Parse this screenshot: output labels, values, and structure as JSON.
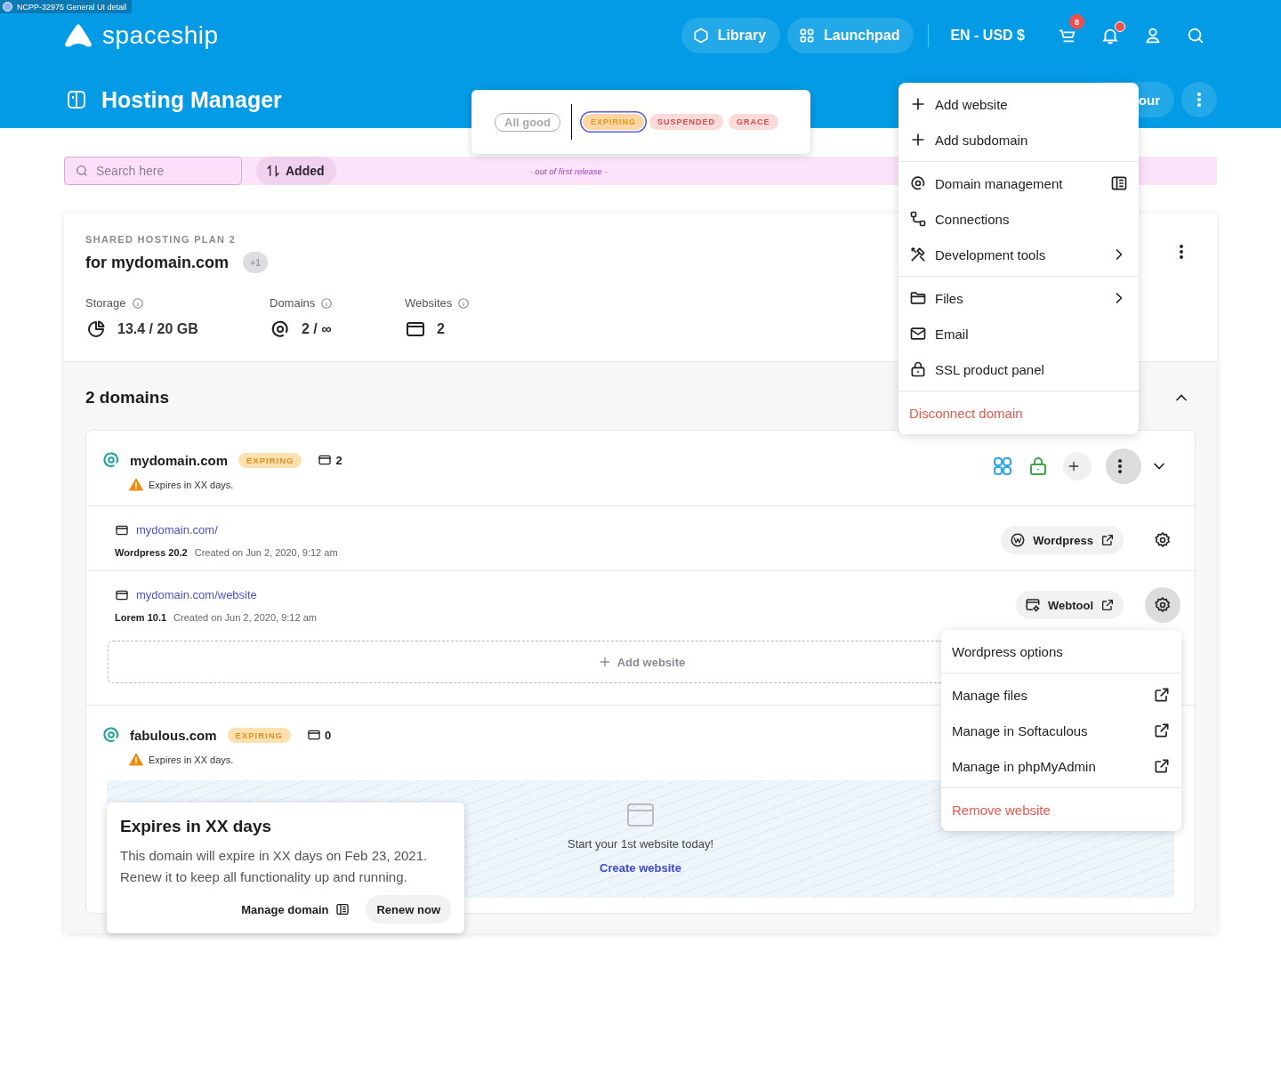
{
  "tab_label": "NCPP-32975 General UI detail",
  "brand": "spaceship",
  "nav": [
    {
      "label": "Library",
      "kind": "hexagon"
    },
    {
      "label": "Launchpad",
      "kind": "grid"
    }
  ],
  "locale": "EN - USD $",
  "cart_count": "8",
  "notifications_unread": true,
  "page_title": "Hosting Manager",
  "header_button": "our",
  "status_chips": [
    {
      "label": "All good",
      "kind": "neutral",
      "selected": false
    },
    {
      "label": "EXPIRING",
      "kind": "warning",
      "selected": true
    },
    {
      "label": "SUSPENDED",
      "kind": "danger",
      "selected": false
    },
    {
      "label": "GRACE",
      "kind": "danger",
      "selected": false
    }
  ],
  "toolbar": {
    "search_placeholder": "Search here",
    "sort_label": "Added",
    "note": "- out of first release -"
  },
  "plan": {
    "eyebrow": "SHARED HOSTING PLAN 2",
    "title": "for mydomain.com",
    "extra_count": "+1",
    "stats": [
      {
        "label": "Storage",
        "value": "13.4 / 20  GB",
        "kind": "pie"
      },
      {
        "label": "Domains",
        "value": "2 / ∞",
        "kind": "target"
      },
      {
        "label": "Websites",
        "value": "2",
        "kind": "window"
      }
    ]
  },
  "domains_heading": "2 domains",
  "domains_expanded": true,
  "domains": [
    {
      "name": "mydomain.com",
      "badge": {
        "label": "EXPIRING",
        "kind": "warning"
      },
      "website_count": "2",
      "warning": "Expires in XX days.",
      "expanded": true,
      "more_active": true,
      "websites": [
        {
          "url": "mydomain.com/",
          "app": "Wordpress 20.2",
          "created": "Created on Jun 2, 2020, 9:12 am",
          "tool": "Wordpress",
          "kind": "wordpress",
          "settings_active": false
        },
        {
          "url": "mydomain.com/website",
          "app": "Lorem 10.1",
          "created": "Created on Jun 2, 2020, 9:12 am",
          "tool": "Webtool",
          "kind": "webtool",
          "settings_active": true
        }
      ],
      "add_website": "Add website"
    },
    {
      "name": "fabulous.com",
      "badge": {
        "label": "EXPIRING",
        "kind": "warning"
      },
      "website_count": "0",
      "warning": "Expires in XX days.",
      "empty_state": {
        "text": "Start your 1st website today!",
        "action": "Create website"
      }
    }
  ],
  "domain_menu": [
    [
      {
        "label": "Add website",
        "kind": "add"
      },
      {
        "label": "Add subdomain",
        "kind": "add"
      }
    ],
    [
      {
        "label": "Domain management",
        "kind": "domain"
      },
      {
        "label": "Connections",
        "kind": "connections"
      },
      {
        "label": "Development tools",
        "kind": "tools"
      }
    ],
    [
      {
        "label": "Files",
        "kind": "files"
      },
      {
        "label": "Email",
        "kind": "mail"
      },
      {
        "label": "SSL product panel",
        "kind": "lock"
      }
    ],
    [
      {
        "label": "Disconnect domain",
        "kind": "danger"
      }
    ]
  ],
  "website_menu": [
    [
      {
        "label": "Wordpress options",
        "kind": "plain"
      }
    ],
    [
      {
        "label": "Manage files",
        "kind": "external"
      },
      {
        "label": "Manage in Softaculous",
        "kind": "external"
      },
      {
        "label": "Manage in phpMyAdmin",
        "kind": "external"
      }
    ],
    [
      {
        "label": "Remove website",
        "kind": "danger"
      }
    ]
  ],
  "tooltip": {
    "title": "Expires in XX days",
    "body": "This domain will expire in XX days on Feb 23, 2021. Renew it to keep all functionality up and running.",
    "secondary": "Manage domain",
    "primary": "Renew now"
  }
}
